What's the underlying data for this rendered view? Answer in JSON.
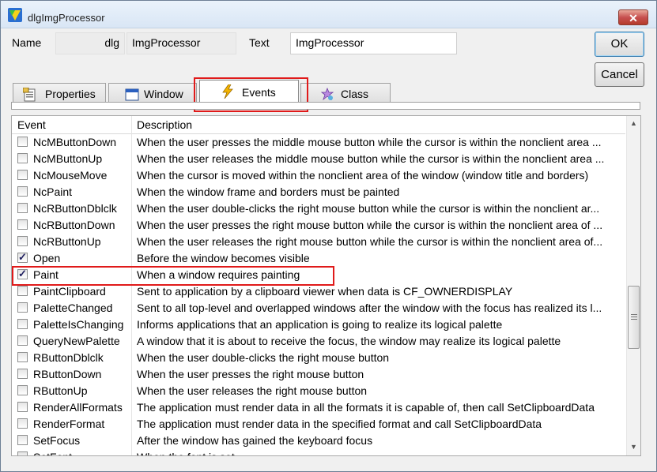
{
  "window": {
    "title": "dlgImgProcessor",
    "close_label": "✕"
  },
  "form": {
    "name_label": "Name",
    "name_prefix": "dlg",
    "name_value": "ImgProcessor",
    "text_label": "Text",
    "text_value": "ImgProcessor"
  },
  "buttons": {
    "ok": "OK",
    "cancel": "Cancel"
  },
  "tabs": [
    {
      "label": "Properties",
      "icon": "properties-icon"
    },
    {
      "label": "Window",
      "icon": "window-icon"
    },
    {
      "label": "Events",
      "icon": "lightning-icon"
    },
    {
      "label": "Class",
      "icon": "class-icon"
    }
  ],
  "grid": {
    "headers": {
      "event": "Event",
      "description": "Description"
    },
    "rows": [
      {
        "event": "NcMButtonDown",
        "description": "When the user presses the middle mouse button while the cursor is within the nonclient area ...",
        "checked": false
      },
      {
        "event": "NcMButtonUp",
        "description": "When the user releases the middle mouse button while the cursor is within the nonclient area ...",
        "checked": false
      },
      {
        "event": "NcMouseMove",
        "description": "When the cursor is moved within the nonclient area of the window (window title and borders)",
        "checked": false
      },
      {
        "event": "NcPaint",
        "description": "When the window frame and borders must be painted",
        "checked": false
      },
      {
        "event": "NcRButtonDblclk",
        "description": "When the user double-clicks the right mouse button while the cursor is within the nonclient ar...",
        "checked": false
      },
      {
        "event": "NcRButtonDown",
        "description": "When the user presses the right mouse button while the cursor is within the nonclient area of ...",
        "checked": false
      },
      {
        "event": "NcRButtonUp",
        "description": "When the user releases the right mouse button while the cursor is within the nonclient area of...",
        "checked": false
      },
      {
        "event": "Open",
        "description": "Before the window becomes visible",
        "checked": true
      },
      {
        "event": "Paint",
        "description": "When a window requires painting",
        "checked": true
      },
      {
        "event": "PaintClipboard",
        "description": "Sent to application by a clipboard viewer when data is CF_OWNERDISPLAY",
        "checked": false
      },
      {
        "event": "PaletteChanged",
        "description": "Sent to all top-level and overlapped windows after the window with the focus has realized its l...",
        "checked": false
      },
      {
        "event": "PaletteIsChanging",
        "description": "Informs applications that an application is going to realize its logical palette",
        "checked": false
      },
      {
        "event": "QueryNewPalette",
        "description": "A window that it is about to receive the focus, the window may realize its logical palette",
        "checked": false
      },
      {
        "event": "RButtonDblclk",
        "description": "When the user double-clicks the right mouse button",
        "checked": false
      },
      {
        "event": "RButtonDown",
        "description": "When the user presses the right mouse button",
        "checked": false
      },
      {
        "event": "RButtonUp",
        "description": "When the user releases the right mouse button",
        "checked": false
      },
      {
        "event": "RenderAllFormats",
        "description": "The application must render data in all the formats it is capable of, then call SetClipboardData",
        "checked": false
      },
      {
        "event": "RenderFormat",
        "description": "The application must render data in the specified format and call SetClipboardData",
        "checked": false
      },
      {
        "event": "SetFocus",
        "description": "After the window has gained the keyboard focus",
        "checked": false
      },
      {
        "event": "SetFont",
        "description": "When the font is set",
        "checked": false
      }
    ]
  },
  "colors": {
    "highlight_box": "#e01a1a",
    "titlebar": "#dce8f6"
  }
}
